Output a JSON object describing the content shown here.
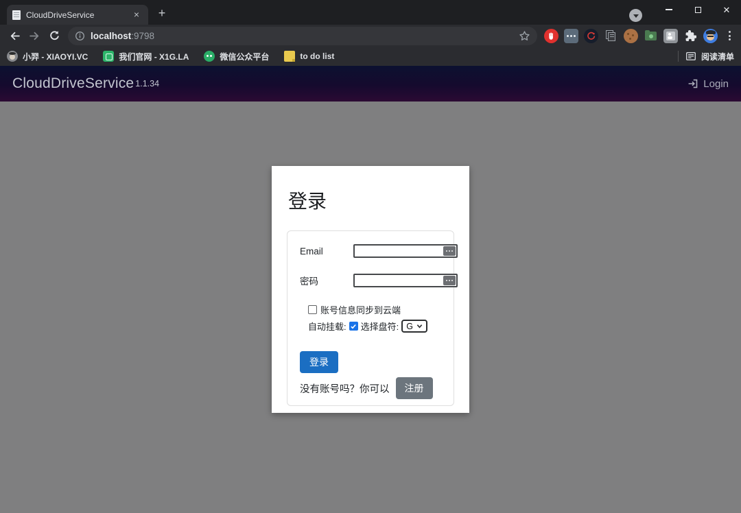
{
  "browser": {
    "tab": {
      "title": "CloudDriveService"
    },
    "address_bar": {
      "host": "localhost",
      "port": ":9798"
    },
    "bookmarks": {
      "items": [
        {
          "icon": "avatar-favicon",
          "label": "小羿 - XIAOYI.VC"
        },
        {
          "icon": "site-favicon",
          "label": "我们官网 - X1G.LA"
        },
        {
          "icon": "wechat-favicon",
          "label": "微信公众平台"
        },
        {
          "icon": "note-favicon",
          "label": "to do list"
        }
      ],
      "reading_list_label": "阅读清单"
    },
    "toolbar_icons": [
      "back-icon",
      "forward-icon",
      "reload-icon",
      "info-icon",
      "bookmark-star-icon",
      "adguard-extension-icon",
      "dots-extension-icon",
      "dark-mode-extension-icon",
      "pages-extension-icon",
      "cookie-extension-icon",
      "folder-extension-icon",
      "image-extension-icon",
      "puzzle-extensions-icon",
      "profile-avatar",
      "menu-kebab-icon"
    ]
  },
  "page": {
    "header": {
      "brand": "CloudDriveService",
      "version": "1.1.34",
      "login_label": "Login"
    },
    "login_card": {
      "title": "登录",
      "email_label": "Email",
      "email_value": "",
      "password_label": "密码",
      "password_value": "",
      "sync_checkbox_label": "账号信息同步到云端",
      "sync_checked": false,
      "automount_label": "自动挂载:",
      "automount_checked": true,
      "drive_label": "选择盘符:",
      "drive_selected": "G",
      "login_button": "登录",
      "register_prompt": "没有账号吗？你可以",
      "register_button": "注册"
    },
    "colors": {
      "primary_button": "#1b6ec2",
      "secondary_button": "#6c757d",
      "header_gradient_top": "#0c1130",
      "header_gradient_bottom": "#2b0a33",
      "body_background": "#7f7f80",
      "checked_checkbox": "#1a73e8"
    }
  }
}
